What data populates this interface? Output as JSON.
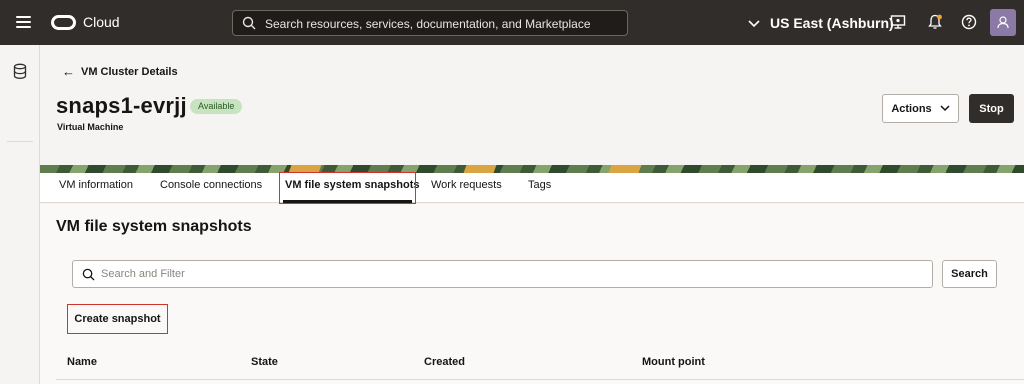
{
  "topbar": {
    "brand": "Cloud",
    "search_placeholder": "Search resources, services, documentation, and Marketplace",
    "region": "US East (Ashburn)"
  },
  "header": {
    "back_label": "VM Cluster Details",
    "title": "snaps1-evrjj",
    "status_badge": "Available",
    "subtitle": "Virtual Machine",
    "actions_label": "Actions",
    "stop_label": "Stop"
  },
  "tabs": [
    {
      "label": "VM information"
    },
    {
      "label": "Console connections"
    },
    {
      "label": "VM file system snapshots"
    },
    {
      "label": "Work requests"
    },
    {
      "label": "Tags"
    }
  ],
  "main": {
    "section_title": "VM file system snapshots",
    "filter_placeholder": "Search and Filter",
    "search_button": "Search",
    "create_button": "Create snapshot",
    "columns": [
      "Name",
      "State",
      "Created",
      "Mount point"
    ]
  },
  "colors": {
    "topbar_bg": "#312d2a",
    "status_badge_bg": "#c8e3c0",
    "highlight_red": "#d0342c"
  },
  "icons": [
    "menu-icon",
    "oracle-logo-icon",
    "search-icon",
    "chevron-down-icon",
    "monitor-icon",
    "bell-icon",
    "help-icon",
    "user-icon",
    "database-icon",
    "arrow-left-icon"
  ]
}
